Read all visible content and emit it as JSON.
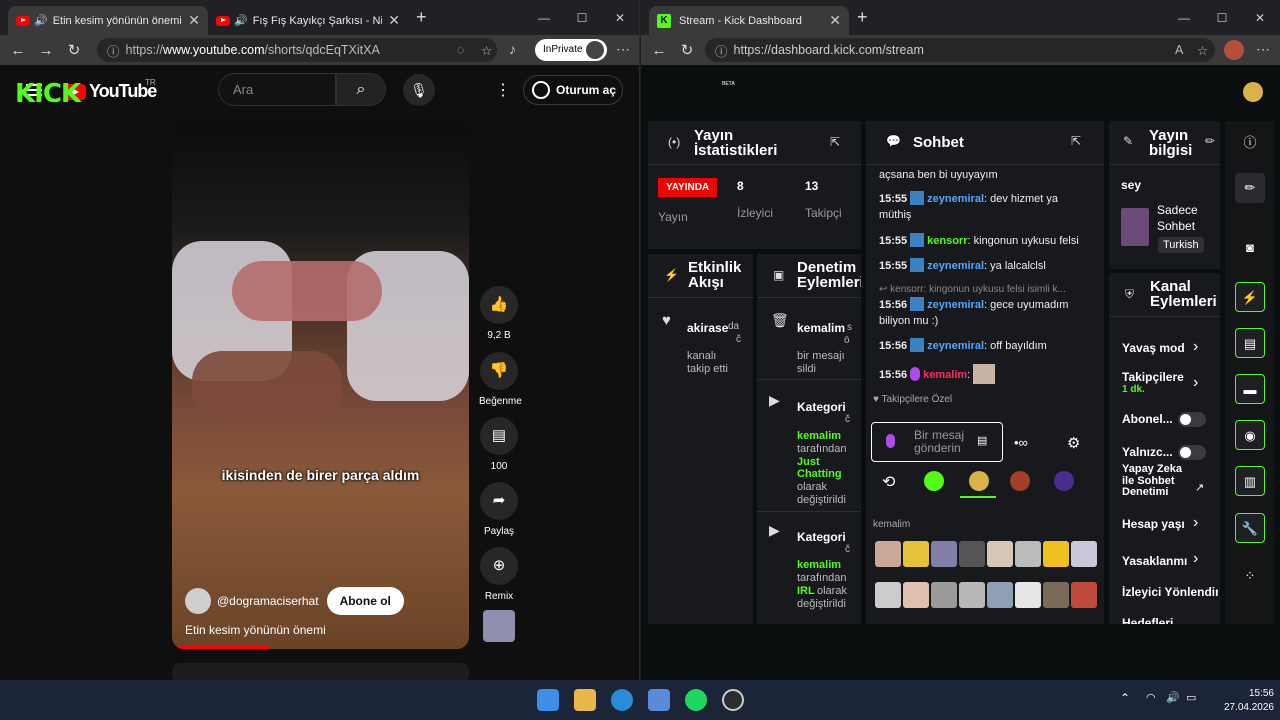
{
  "left_browser": {
    "tabs": [
      {
        "title": "Etin kesim yönünün önemi - Y"
      },
      {
        "title": "Fış Fış Kayıkçı Şarkısı - Ninnisi"
      }
    ],
    "url_prefix": "https://",
    "url_domain": "www.youtube.com",
    "url_path": "/shorts/qdcEqTXitXA",
    "inprivate": "InPrivate"
  },
  "youtube": {
    "logo": "YouTube",
    "region": "TR",
    "search_placeholder": "Ara",
    "signin": "Oturum aç",
    "caption": "ikisinden de birer parça aldım",
    "channel": "@dogramaciserhat",
    "subscribe": "Abone ol",
    "video_title": "Etin kesim yönünün önemi",
    "likes": "9,2 B",
    "dislike": "Beğenme",
    "comments": "100",
    "share": "Paylaş",
    "remix": "Remix"
  },
  "right_browser": {
    "tab_title": "Stream - Kick Dashboard",
    "url": "https://dashboard.kick.com/stream"
  },
  "kick": {
    "logo": "KICK",
    "beta": "BETA",
    "stats": {
      "title_l1": "Yayın",
      "title_l2": "İstatistikleri",
      "live": "YAYINDA",
      "live_label": "Yayın",
      "viewers": "8",
      "viewers_label": "İzleyici",
      "followers": "13",
      "followers_label": "Takipçi"
    },
    "activity": {
      "title_l1": "Etkinlik",
      "title_l2": "Akışı",
      "user": "akirase",
      "suffix": "da",
      "suffix2": "č",
      "line1": "kanalı",
      "line2": "takip etti"
    },
    "moderation": {
      "title_l1": "Denetim",
      "title_l2": "Eylemleri",
      "items": [
        {
          "user": "kemalim",
          "extra": "s",
          "extra2": "ö",
          "l1": "bir mesajı",
          "l2": "sildi"
        },
        {
          "head": "Kategori",
          "extra": "č",
          "user": "kemalim",
          "l1": "tarafından",
          "cat1": "Just",
          "cat2": "Chatting",
          "l3": "olarak",
          "l4": "değiştirildi"
        },
        {
          "head": "Kategori",
          "extra": "č",
          "user": "kemalim",
          "l1": "tarafından",
          "cat": "IRL",
          "l3": "olarak",
          "l4": "değiştirildi"
        }
      ]
    },
    "chat": {
      "title": "Sohbet",
      "messages": [
        {
          "time": "",
          "user": "",
          "text": "açsana ben bi uyuyayım"
        },
        {
          "time": "15:55",
          "user": "zeynemiral",
          "text": "dev hizmet ya müthiş"
        },
        {
          "time": "15:55",
          "user": "kensorr",
          "text": "kingonun uykusu felsi"
        },
        {
          "time": "15:55",
          "user": "zeynemiral",
          "text": "ya lalcalclsl"
        },
        {
          "time": "15:56",
          "user": "zeynemiral",
          "text": "gece uyumadım biliyon mu :)"
        },
        {
          "time": "15:56",
          "user": "zeynemiral",
          "text": "off bayıldım"
        },
        {
          "time": "15:56",
          "user": "kemalim",
          "text": ""
        }
      ],
      "reply_preview": "kensorr: kingonun uykusu felsi isimli k...",
      "followers_only": "Takipçilere Özel",
      "input_placeholder": "Bir mesaj gönderin",
      "emote_section": "kemalim"
    },
    "stream_info": {
      "title_l1": "Yayın",
      "title_l2": "bilgisi",
      "stream_title": "sey",
      "category": "Sadece Sohbet",
      "language": "Turkish"
    },
    "channel_actions": {
      "title_l1": "Kanal",
      "title_l2": "Eylemleri",
      "items": [
        {
          "label": "Yavaş mod"
        },
        {
          "label": "Takipçilere",
          "sub": "1 dk."
        },
        {
          "label": "Abonel..."
        },
        {
          "label": "Yalnızc..."
        },
        {
          "label": "Yapay Zeka ile Sohbet Denetimi"
        },
        {
          "label": "Hesap yaşı"
        },
        {
          "label": "Yasaklanmı"
        },
        {
          "label": "İzleyici Yönlendir"
        },
        {
          "label": "Hedefleri"
        }
      ]
    }
  },
  "taskbar": {
    "time": "15:56",
    "date": "27.04.2026"
  }
}
